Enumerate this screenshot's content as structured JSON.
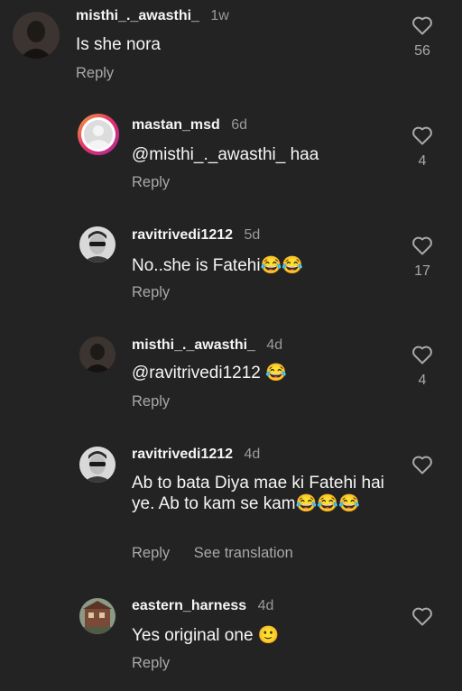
{
  "reply_label": "Reply",
  "see_translation_label": "See translation",
  "comments": [
    {
      "user": "misthi_._awasthi_",
      "time": "1w",
      "text": "Is she nora",
      "likes": "56",
      "avatar": "user-photo-dark"
    },
    {
      "user": "mastan_msd",
      "time": "6d",
      "text": "@misthi_._awasthi_ haa",
      "likes": "4",
      "avatar": "default-avatar-story-ring"
    },
    {
      "user": "ravitrivedi1212",
      "time": "5d",
      "text": "No..she is Fatehi😂😂",
      "likes": "17",
      "avatar": "user-photo-sunglasses"
    },
    {
      "user": "misthi_._awasthi_",
      "time": "4d",
      "text": "@ravitrivedi1212 😂",
      "likes": "4",
      "avatar": "user-photo-dark"
    },
    {
      "user": "ravitrivedi1212",
      "time": "4d",
      "text": "Ab to bata Diya mae ki Fatehi hai ye. Ab to kam se kam😂😂😂",
      "likes": "",
      "avatar": "user-photo-sunglasses"
    },
    {
      "user": "eastern_harness",
      "time": "4d",
      "text": "Yes original one 🙂",
      "likes": "",
      "avatar": "user-photo-building"
    }
  ],
  "colors": {
    "background": "#232323",
    "secondary_text": "#a8a8a8",
    "story_ring": "#e1306c"
  }
}
